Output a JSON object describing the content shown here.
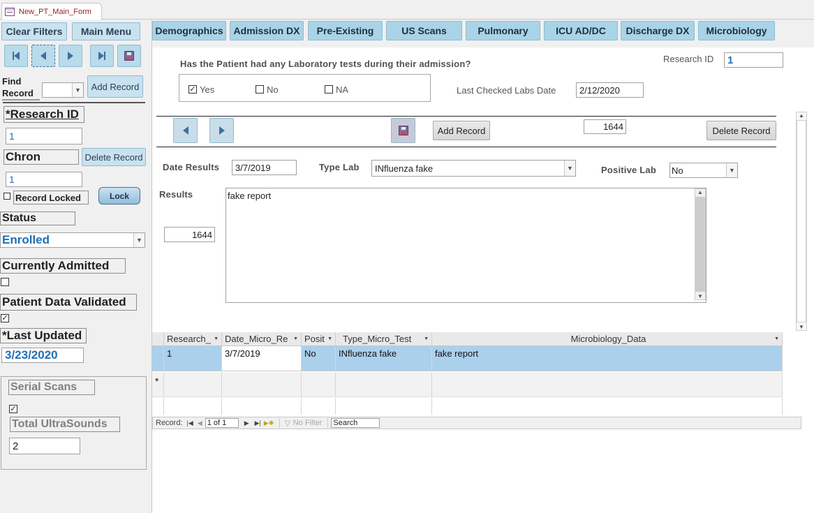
{
  "window": {
    "tab_title": "New_PT_Main_Form"
  },
  "left": {
    "clear_filters": "Clear Filters",
    "main_menu": "Main Menu",
    "find_record_label": "Find Record",
    "add_record": "Add Record",
    "research_id_label": "*Research ID",
    "research_id_value": "1",
    "chron_label": "Chron",
    "delete_record": "Delete Record",
    "chron_value": "1",
    "record_locked_label": "Record Locked",
    "lock_button": "Lock",
    "status_label": "Status",
    "status_value": "Enrolled",
    "currently_admitted_label": "Currently Admitted",
    "patient_data_validated_label": "Patient Data Validated",
    "patient_data_validated_checked": true,
    "last_updated_label": "*Last Updated",
    "last_updated_value": "3/23/2020",
    "serial_scans_label": "Serial Scans",
    "serial_scans_checked": true,
    "total_ultrasounds_label": "Total UltraSounds",
    "total_ultrasounds_value": "2"
  },
  "tabs": [
    "Demographics",
    "Admission DX",
    "Pre-Existing",
    "US Scans",
    "Pulmonary",
    "ICU AD/DC",
    "Discharge DX",
    "Microbiology"
  ],
  "main": {
    "question": "Has the Patient had any Laboratory tests during their admission?",
    "options": [
      {
        "label": "Yes",
        "checked": true
      },
      {
        "label": "No",
        "checked": false
      },
      {
        "label": "NA",
        "checked": false
      }
    ],
    "research_id_label": "Research ID",
    "research_id_value": "1",
    "last_checked_label": "Last Checked Labs Date",
    "last_checked_value": "2/12/2020",
    "sub_add_record": "Add Record",
    "sub_record_number": "1644",
    "sub_delete_record": "Delete Record",
    "date_results_label": "Date Results",
    "date_results_value": "3/7/2019",
    "type_lab_label": "Type Lab",
    "type_lab_value": "INfluenza fake",
    "positive_lab_label": "Positive Lab",
    "positive_lab_value": "No",
    "results_label": "Results",
    "results_number": "1644",
    "results_text": "fake report"
  },
  "datasheet": {
    "columns": [
      "Research_",
      "Date_Micro_Re",
      "Posit",
      "Type_Micro_Test",
      "Microbiology_Data"
    ],
    "rows": [
      [
        "1",
        "3/7/2019",
        "No",
        "INfluenza fake",
        "fake report"
      ]
    ],
    "new_row_marker": "*"
  },
  "record_nav": {
    "label": "Record:",
    "position": "1 of 1",
    "no_filter": "No Filter",
    "search": "Search"
  },
  "colors": {
    "tab_button": "#a9d3e6",
    "selected_row": "#abd0ec",
    "accent_text": "#1f6fb5"
  }
}
